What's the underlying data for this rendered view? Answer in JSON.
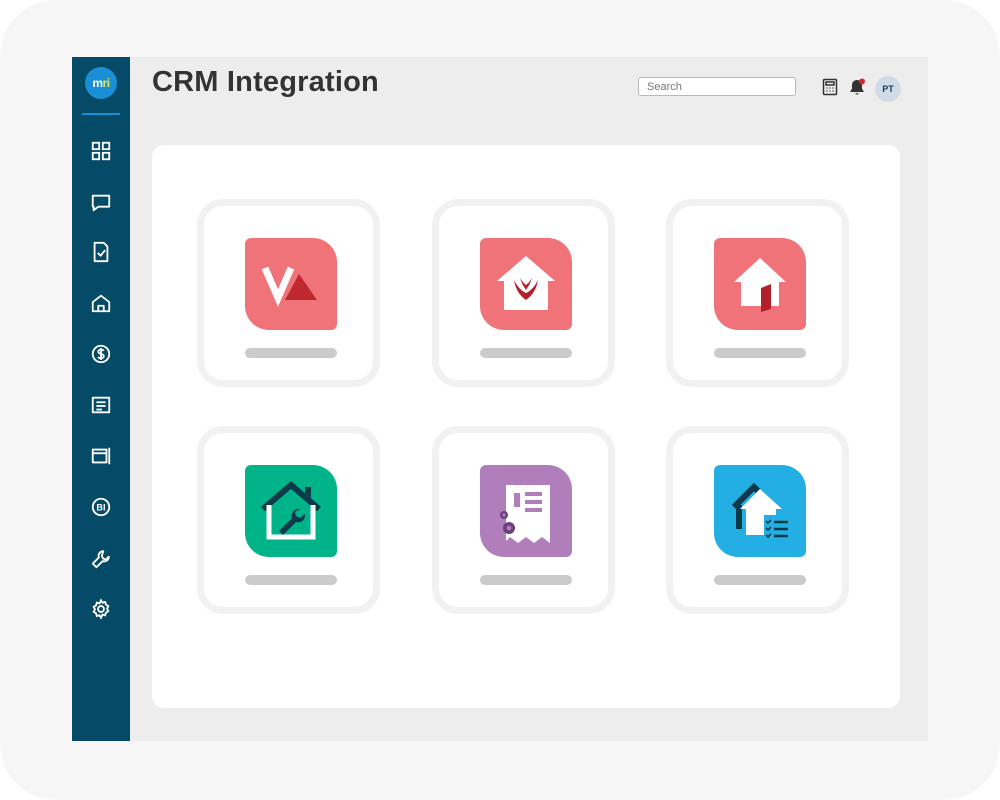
{
  "app": {
    "logo_text_main": "m",
    "logo_text_accent": "ri",
    "colors": {
      "sidebar": "#054a66",
      "logo": "#1b8fd6",
      "tile_red": "#f0737a",
      "tile_green": "#00b388",
      "tile_purple": "#b07ebb",
      "tile_blue": "#23aee4"
    }
  },
  "header": {
    "title": "CRM Integration",
    "search_placeholder": "Search",
    "avatar_initials": "PT",
    "icons": [
      "calculator-icon",
      "bell-icon"
    ]
  },
  "sidebar": {
    "items": [
      {
        "name": "dashboard-icon"
      },
      {
        "name": "chat-icon"
      },
      {
        "name": "tasks-icon"
      },
      {
        "name": "property-icon"
      },
      {
        "name": "finance-icon"
      },
      {
        "name": "documents-icon"
      },
      {
        "name": "reports-icon"
      },
      {
        "name": "bi-icon",
        "text": "BI"
      },
      {
        "name": "maintenance-icon"
      },
      {
        "name": "settings-icon"
      }
    ]
  },
  "integrations": [
    {
      "icon": "va-logo-icon",
      "color": "#f0737a"
    },
    {
      "icon": "house-swoosh-icon",
      "color": "#f0737a"
    },
    {
      "icon": "house-door-icon",
      "color": "#f0737a"
    },
    {
      "icon": "house-wrench-icon",
      "color": "#00b388"
    },
    {
      "icon": "document-gears-icon",
      "color": "#b07ebb"
    },
    {
      "icon": "house-checklist-icon",
      "color": "#23aee4"
    }
  ]
}
